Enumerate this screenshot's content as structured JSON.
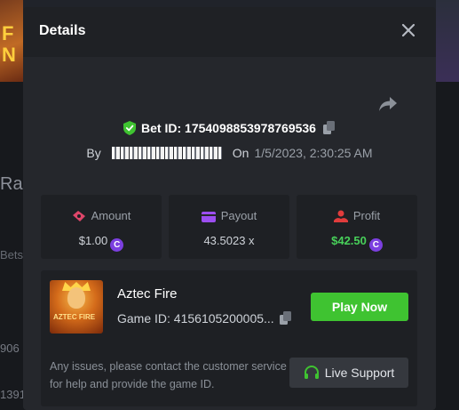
{
  "background": {
    "thumb_left_text": "F\nN",
    "section_text": "Ra",
    "bets_text": "Bets",
    "row1_text": "906",
    "row2_text": "1391"
  },
  "modal": {
    "title": "Details",
    "bet_id_label": "Bet ID: 1754098853978769536",
    "by_label": "By",
    "on_label": "On",
    "date": "1/5/2023, 2:30:25 AM"
  },
  "stats": [
    {
      "label": "Amount",
      "value": "$1.00",
      "has_coin": true,
      "color": "#e0466a"
    },
    {
      "label": "Payout",
      "value": "43.5023 x",
      "has_coin": false,
      "color": "#9c4ef0"
    },
    {
      "label": "Profit",
      "value": "$42.50",
      "has_coin": true,
      "color": "#e03c3c"
    }
  ],
  "game": {
    "name": "Aztec Fire",
    "game_id": "Game ID: 4156105200005...",
    "thumb_text": "AZTEC FIRE",
    "play_label": "Play Now",
    "issue_text": "Any issues, please contact the customer service for help and provide the game ID.",
    "support_label": "Live Support"
  },
  "icons": {
    "close": "close-icon",
    "share": "share-icon",
    "shield": "shield-check-icon",
    "copy": "copy-icon",
    "coin": "coin-icon",
    "headset": "headset-icon"
  },
  "colors": {
    "accent_green": "#3fc331",
    "profit_green": "#48d15a",
    "coin_purple": "#7c3fe0"
  }
}
